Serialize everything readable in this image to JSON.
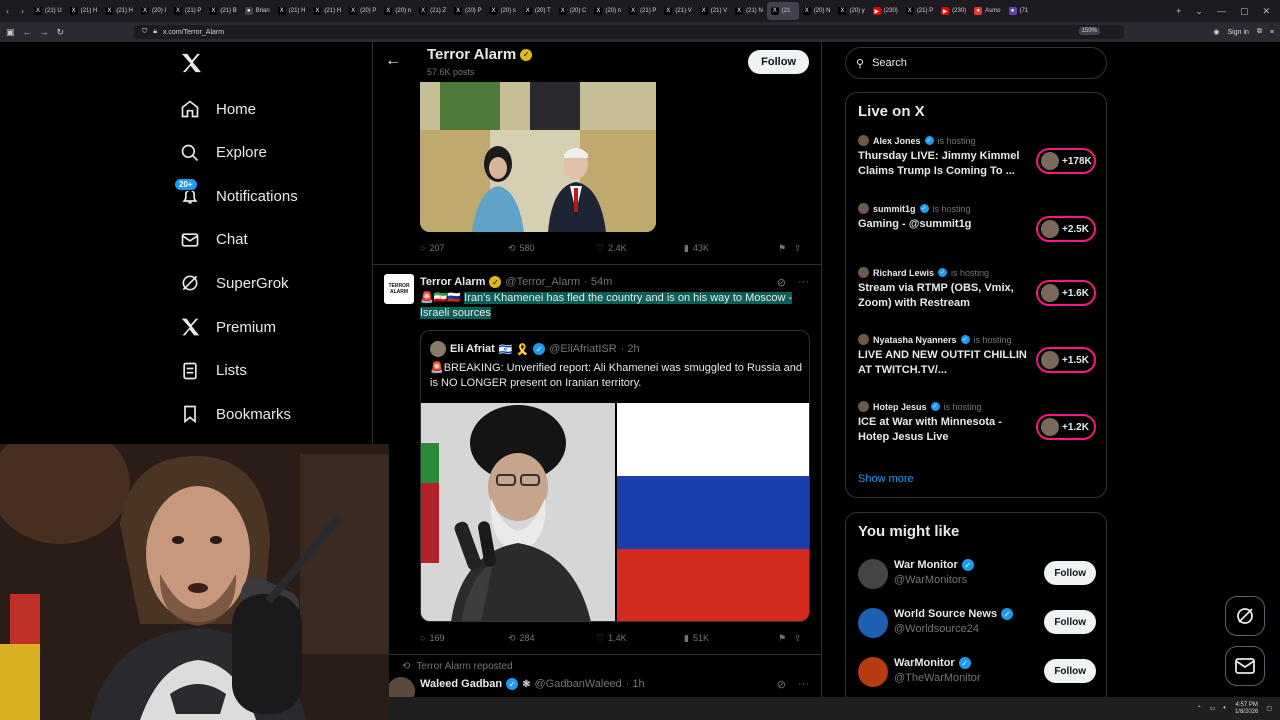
{
  "browser": {
    "tabs": [
      {
        "label": "(21) U",
        "fav": "X",
        "color": "#000"
      },
      {
        "label": "(21) H",
        "fav": "X",
        "color": "#000"
      },
      {
        "label": "(21) H",
        "fav": "X",
        "color": "#000"
      },
      {
        "label": "(20) I",
        "fav": "X",
        "color": "#000"
      },
      {
        "label": "(21) P",
        "fav": "X",
        "color": "#000"
      },
      {
        "label": "(21) B",
        "fav": "X",
        "color": "#000"
      },
      {
        "label": "Brian",
        "fav": "●",
        "color": "#444"
      },
      {
        "label": "(21) H",
        "fav": "X",
        "color": "#000"
      },
      {
        "label": "(21) H",
        "fav": "X",
        "color": "#000"
      },
      {
        "label": "(20) P",
        "fav": "X",
        "color": "#000"
      },
      {
        "label": "(20) n",
        "fav": "X",
        "color": "#000"
      },
      {
        "label": "(21) Z",
        "fav": "X",
        "color": "#000"
      },
      {
        "label": "(20) P",
        "fav": "X",
        "color": "#000"
      },
      {
        "label": "(20) s",
        "fav": "X",
        "color": "#000"
      },
      {
        "label": "(20) T",
        "fav": "X",
        "color": "#000"
      },
      {
        "label": "(20) C",
        "fav": "X",
        "color": "#000"
      },
      {
        "label": "(20) n",
        "fav": "X",
        "color": "#000"
      },
      {
        "label": "(21) P",
        "fav": "X",
        "color": "#000"
      },
      {
        "label": "(21) V",
        "fav": "X",
        "color": "#000"
      },
      {
        "label": "(21) V",
        "fav": "X",
        "color": "#000"
      },
      {
        "label": "(21) N",
        "fav": "X",
        "color": "#000"
      },
      {
        "label": "(21",
        "fav": "X",
        "color": "#000",
        "active": true
      },
      {
        "label": "(20) N",
        "fav": "X",
        "color": "#000"
      },
      {
        "label": "(20) y",
        "fav": "X",
        "color": "#000"
      },
      {
        "label": "(230)",
        "fav": "▶",
        "color": "#e00"
      },
      {
        "label": "(21) P",
        "fav": "X",
        "color": "#000"
      },
      {
        "label": "(230)",
        "fav": "▶",
        "color": "#e00"
      },
      {
        "label": "Asmo",
        "fav": "●",
        "color": "#e33"
      },
      {
        "label": "(71",
        "fav": "●",
        "color": "#6441a5"
      }
    ],
    "url": "x.com/Terror_Alarm",
    "zoom": "150%",
    "sign_in": "Sign in"
  },
  "nav": {
    "items": [
      {
        "label": "Home",
        "icon": "home-icon"
      },
      {
        "label": "Explore",
        "icon": "search-icon"
      },
      {
        "label": "Notifications",
        "icon": "bell-icon",
        "badge": "20+"
      },
      {
        "label": "Chat",
        "icon": "mail-icon"
      },
      {
        "label": "SuperGrok",
        "icon": "grok-icon"
      },
      {
        "label": "Premium",
        "icon": "x-logo-icon"
      },
      {
        "label": "Lists",
        "icon": "list-icon"
      },
      {
        "label": "Bookmarks",
        "icon": "bookmark-icon"
      }
    ]
  },
  "profile": {
    "name": "Terror Alarm",
    "posts": "57.6K posts",
    "follow_label": "Follow"
  },
  "post1": {
    "replies": "207",
    "reposts": "580",
    "likes": "2.4K",
    "views": "43K"
  },
  "post2": {
    "avatar_text": "TERROR ALARM",
    "name": "Terror Alarm",
    "handle": "@Terror_Alarm",
    "time": "· 54m",
    "flags": "🚨🇮🇷🇷🇺",
    "text": "Iran's Khamenei has fled the country and is on his way to Moscow - Israeli sources",
    "quote": {
      "name": "Eli Afriat",
      "emoji": "🇮🇱 🎗️",
      "handle": "@EliAfriatISR",
      "time": "· 2h",
      "text": "🚨BREAKING: Unverified report: Ali Khamenei was smuggled to Russia and is NO LONGER present on Iranian territory."
    },
    "replies": "169",
    "reposts": "284",
    "likes": "1.4K",
    "views": "51K"
  },
  "post3": {
    "reposted_label": "Terror Alarm reposted",
    "name": "Waleed Gadban",
    "handle": "@GadbanWaleed",
    "time": "· 1h"
  },
  "search": {
    "placeholder": "Search"
  },
  "live": {
    "title": "Live on X",
    "items": [
      {
        "host": "Alex Jones",
        "status": "is hosting",
        "title": "Thursday LIVE: Jimmy Kimmel Claims Trump Is Coming To ...",
        "count": "+178K"
      },
      {
        "host": "summit1g",
        "status": "is hosting",
        "title": "Gaming - @summit1g",
        "count": "+2.5K"
      },
      {
        "host": "Richard Lewis",
        "status": "is hosting",
        "title": "Stream via RTMP (OBS, Vmix, Zoom) with Restream",
        "count": "+1.6K"
      },
      {
        "host": "Nyatasha Nyanners",
        "status": "is hosting",
        "title": "LIVE AND NEW OUTFIT CHILLIN AT TWITCH.TV/...",
        "count": "+1.5K"
      },
      {
        "host": "Hotep Jesus",
        "status": "is hosting",
        "title": "ICE at War with Minnesota - Hotep Jesus Live",
        "count": "+1.2K"
      }
    ],
    "show_more": "Show more"
  },
  "suggestions": {
    "title": "You might like",
    "items": [
      {
        "name": "War Monitor",
        "handle": "@WarMonitors",
        "follow": "Follow",
        "color": "#444"
      },
      {
        "name": "World Source News",
        "handle": "@Worldsource24",
        "follow": "Follow",
        "color": "#1d5fb0"
      },
      {
        "name": "WarMonitor",
        "handle": "@TheWarMonitor",
        "follow": "Follow",
        "color": "#b83a10"
      }
    ]
  },
  "taskbar": {
    "time": "4:57 PM",
    "date": "1/8/2026"
  }
}
